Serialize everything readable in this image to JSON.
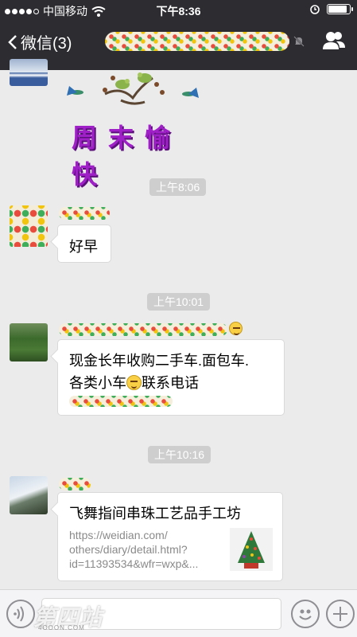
{
  "status_bar": {
    "carrier": "中国移动",
    "time": "下午8:36",
    "battery_level": 0.9
  },
  "nav": {
    "back_label": "微信(3)",
    "icons": [
      "chevron-left-icon",
      "mute-icon",
      "group-members-icon"
    ]
  },
  "messages": [
    {
      "type": "sticker",
      "sticker_text": "周末愉快"
    },
    {
      "type": "time",
      "text": "上午8:06"
    },
    {
      "type": "text",
      "text": "好早"
    },
    {
      "type": "time",
      "text": "上午10:01"
    },
    {
      "type": "text",
      "line1": "现金长年收购二手车.面包车.",
      "line2_prefix": "各类小车",
      "line2_suffix": "联系电话"
    },
    {
      "type": "time",
      "text": "上午10:16"
    },
    {
      "type": "link",
      "title": "飞舞指间串珠工艺品手工坊",
      "desc_line1": "https://weidian.com/",
      "desc_line2": "others/diary/detail.html?",
      "desc_line3": "id=11393534&wfr=wxp&..."
    }
  ],
  "watermark": {
    "text": "第四站",
    "sub": "4OOON.COM"
  },
  "colors": {
    "nav_bg": "#2d2c31",
    "chat_bg": "#ebebeb",
    "time_chip": "#cecece"
  }
}
